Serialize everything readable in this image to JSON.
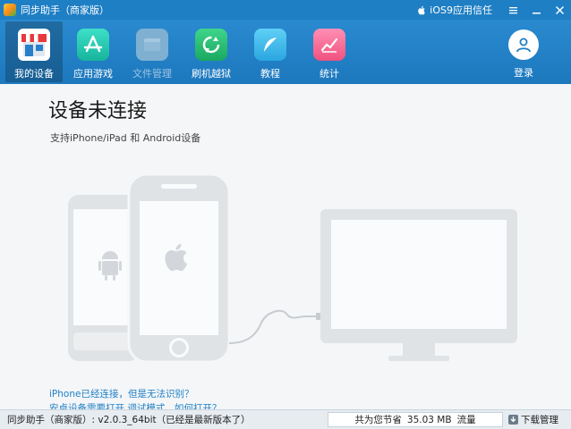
{
  "window": {
    "title": "同步助手（商家版）",
    "ios_trust_label": "iOS9应用信任"
  },
  "toolbar": {
    "items": [
      {
        "label": "我的设备",
        "icon": "store-icon",
        "active": true
      },
      {
        "label": "应用游戏",
        "icon": "app-store-icon"
      },
      {
        "label": "文件管理",
        "icon": "folder-icon",
        "disabled": true
      },
      {
        "label": "刷机越狱",
        "icon": "refresh-icon"
      },
      {
        "label": "教程",
        "icon": "feather-icon"
      },
      {
        "label": "统计",
        "icon": "chart-icon"
      }
    ],
    "login_label": "登录"
  },
  "main": {
    "headline": "设备未连接",
    "subline": "支持iPhone/iPad 和 Android设备",
    "help_links": [
      "iPhone已经连接，但是无法识别？",
      "安卓设备需要打开 调试模式，如何打开？"
    ]
  },
  "status": {
    "version_text": "同步助手（商家版）: v2.0.3_64bit（已经是最新版本了）",
    "saving_prefix": "共为您节省",
    "saving_value": "35.03 MB",
    "saving_suffix": "流量",
    "download_manager": "下载管理"
  },
  "colors": {
    "titlebar": "#1f7fc4",
    "toolbar": "#2280c6",
    "link": "#1f7fc4",
    "device_gray": "#e0e3e6"
  }
}
